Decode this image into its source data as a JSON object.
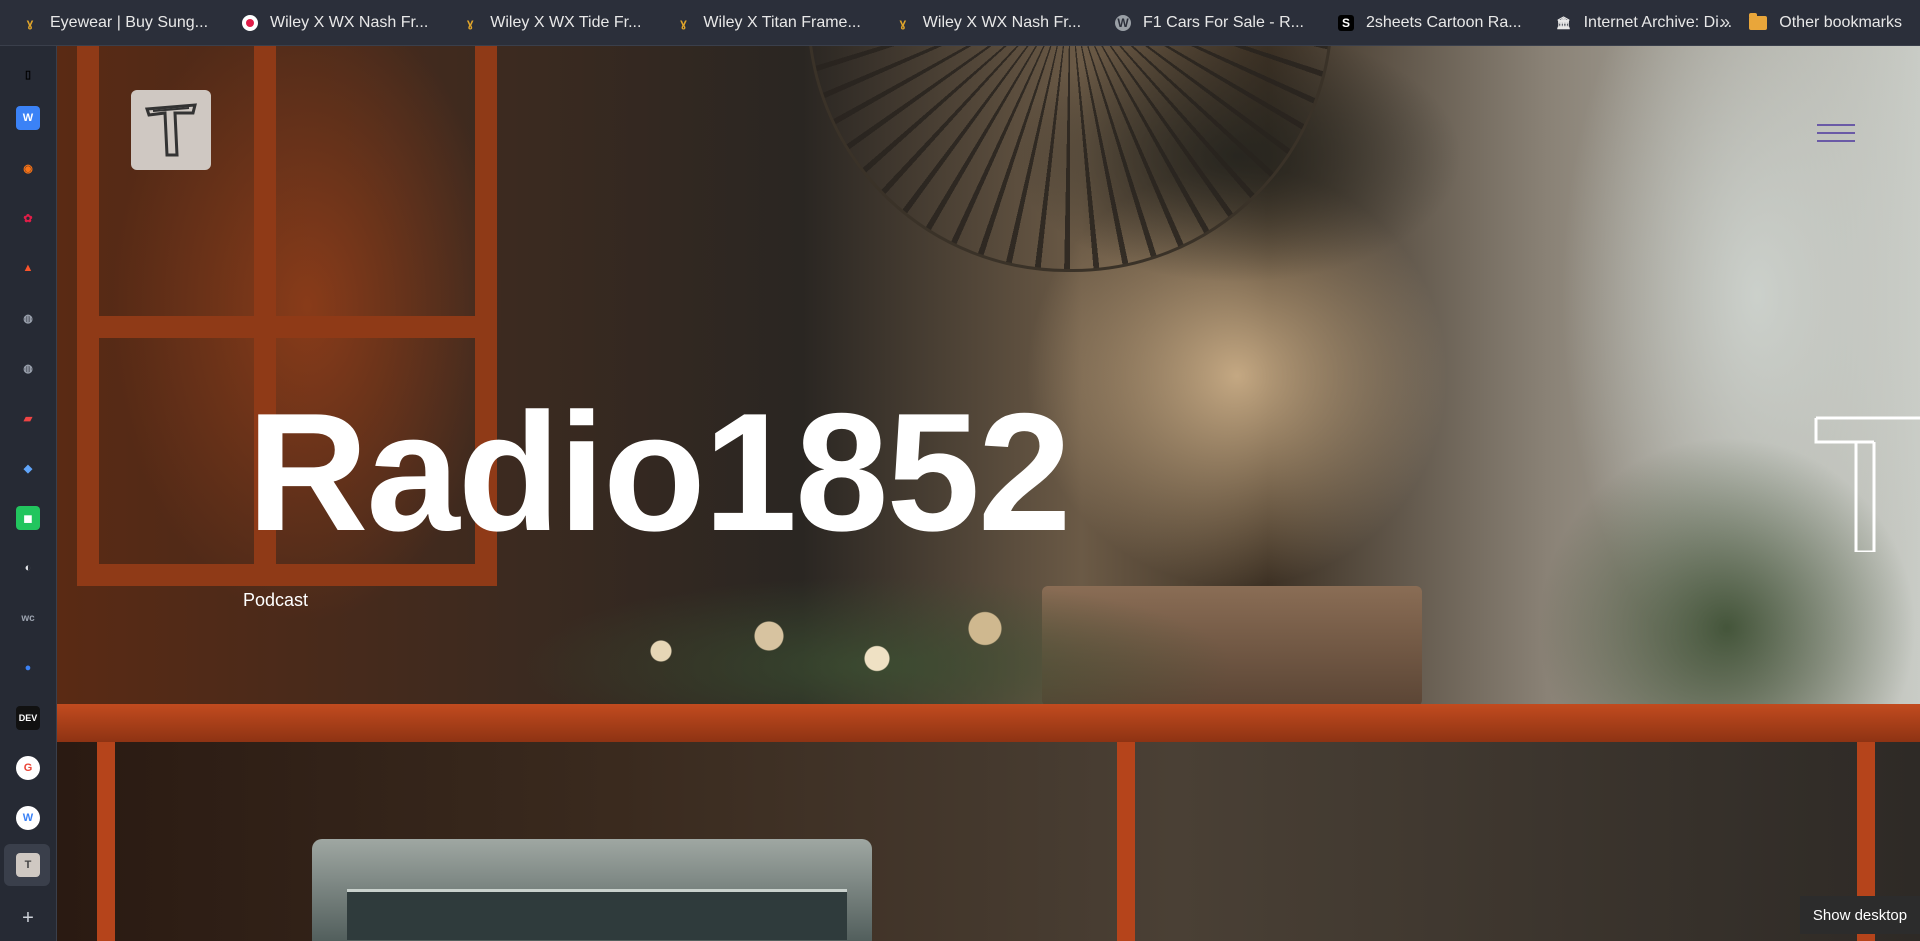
{
  "bookmarks_bar": {
    "items": [
      {
        "label": "Eyewear | Buy Sung...",
        "icon": "wiley-x-icon"
      },
      {
        "label": "Wiley X WX Nash Fr...",
        "icon": "target-icon"
      },
      {
        "label": "Wiley X WX Tide Fr...",
        "icon": "wiley-x-icon"
      },
      {
        "label": "Wiley X Titan Frame...",
        "icon": "wiley-x-icon"
      },
      {
        "label": "Wiley X WX Nash Fr...",
        "icon": "wiley-x-icon"
      },
      {
        "label": "F1 Cars For Sale - R...",
        "icon": "wordpress-icon"
      },
      {
        "label": "2sheets Cartoon Ra...",
        "icon": "s-icon"
      },
      {
        "label": "Internet Archive: Di...",
        "icon": "archive-icon"
      }
    ],
    "overflow_label": "»",
    "other_bookmarks_label": "Other bookmarks"
  },
  "sidebar": {
    "items": [
      {
        "name": "sidebar-toggle-icon",
        "glyph": "▯",
        "color": "#cfd3da"
      },
      {
        "name": "site-w-icon",
        "glyph": "W",
        "color": "#3b82f6"
      },
      {
        "name": "fox-app-icon",
        "glyph": "◉",
        "color": "#f97316"
      },
      {
        "name": "huawei-icon",
        "glyph": "✿",
        "color": "#e11d48"
      },
      {
        "name": "brave-icon",
        "glyph": "▲",
        "color": "#fb542b"
      },
      {
        "name": "globe-icon",
        "glyph": "◍",
        "color": "#9ca3af"
      },
      {
        "name": "globe-icon-2",
        "glyph": "◍",
        "color": "#9ca3af"
      },
      {
        "name": "car-icon",
        "glyph": "▰",
        "color": "#ef4444"
      },
      {
        "name": "bird-icon",
        "glyph": "◆",
        "color": "#60a5fa"
      },
      {
        "name": "chart-app-icon",
        "glyph": "◼",
        "color": "#22c55e"
      },
      {
        "name": "penguin-icon",
        "glyph": "◐",
        "color": "#e5e7eb"
      },
      {
        "name": "wc-icon",
        "glyph": "wc",
        "color": "#1f2937"
      },
      {
        "name": "cloud-app-icon",
        "glyph": "●",
        "color": "#3b82f6"
      },
      {
        "name": "dev-icon",
        "glyph": "DEV",
        "color": "#111111"
      },
      {
        "name": "google-icon",
        "glyph": "G",
        "color": "#ea4335"
      },
      {
        "name": "wordpress-icon",
        "glyph": "W",
        "color": "#60a5fa"
      },
      {
        "name": "radio-site-icon",
        "glyph": "T",
        "color": "#cfc8c2"
      },
      {
        "name": "add-icon",
        "glyph": "+",
        "color": "#cfd3da"
      }
    ]
  },
  "hero": {
    "title": "Radio1852",
    "subtitle": "Podcast"
  },
  "taskbar": {
    "show_desktop_label": "Show desktop"
  }
}
